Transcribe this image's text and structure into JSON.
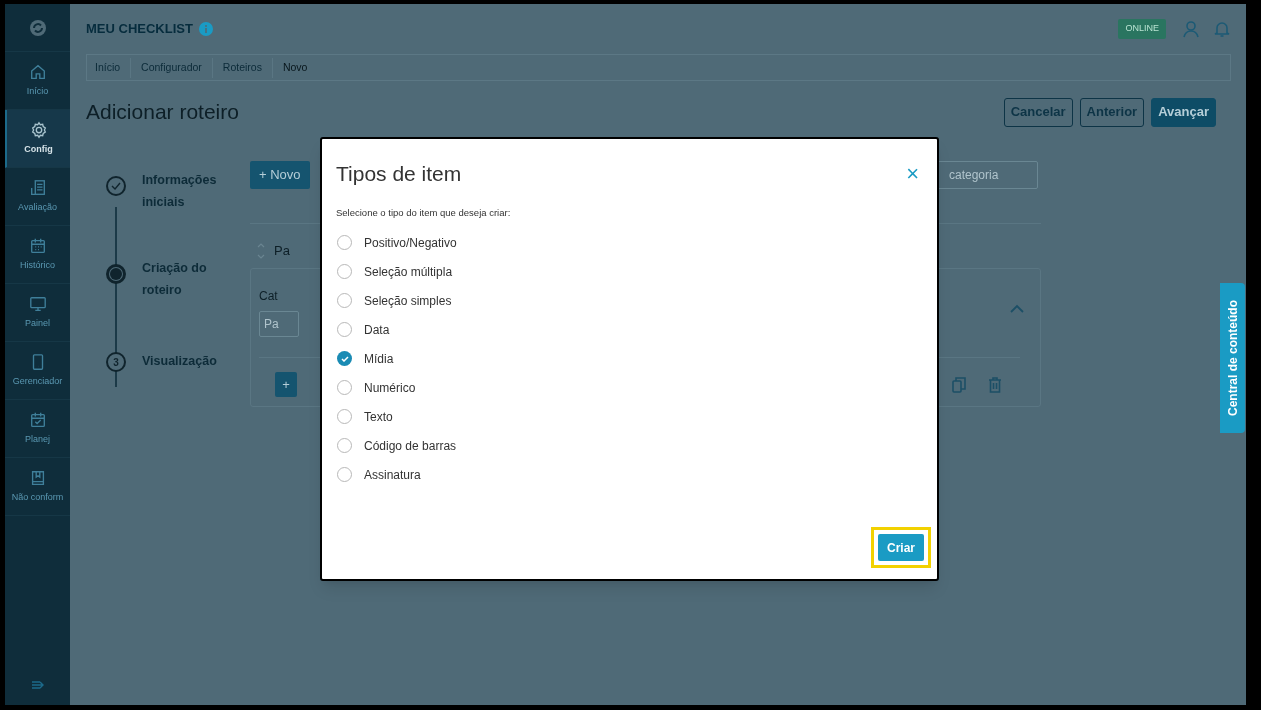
{
  "app": {
    "title": "MEU CHECKLIST"
  },
  "sidebar": {
    "items": [
      {
        "label": "Início",
        "kind": "home",
        "selected": false
      },
      {
        "label": "Config",
        "kind": "gear",
        "selected": true
      },
      {
        "label": "Avaliação",
        "kind": "sheet",
        "selected": false
      },
      {
        "label": "Histórico",
        "kind": "calendar",
        "selected": false
      },
      {
        "label": "Painel",
        "kind": "monitor",
        "selected": false
      },
      {
        "label": "Gerenciador",
        "kind": "phone",
        "selected": false
      },
      {
        "label": "Planej",
        "kind": "calendar-check",
        "selected": false
      },
      {
        "label": "Não conform",
        "kind": "book",
        "selected": false
      }
    ]
  },
  "header": {
    "status": "ONLINE"
  },
  "breadcrumb": [
    "Início",
    "Configurador",
    "Roteiros",
    "Novo"
  ],
  "page": {
    "title": "Adicionar roteiro",
    "actions": [
      {
        "label": "Cancelar",
        "kind": "outline"
      },
      {
        "label": "Anterior",
        "kind": "outline"
      },
      {
        "label": "Avançar",
        "kind": "primary"
      }
    ]
  },
  "steps": [
    {
      "label": "Informações iniciais",
      "done": true,
      "current": false
    },
    {
      "label": "Criação do roteiro",
      "done": false,
      "current": true
    },
    {
      "label": "Visualização",
      "done": false,
      "current": false,
      "number": "3"
    }
  ],
  "editor": {
    "new_button": "+ Novo",
    "sort_label": "Pa",
    "card_label": "Cat",
    "field_placeholder": "Pa",
    "category_placeholder": "categoria",
    "add_button": "+"
  },
  "dialog": {
    "title": "Tipos de item",
    "close": "×",
    "prompt": "Selecione o tipo do item que deseja criar:",
    "options": [
      {
        "label": "Positivo/Negativo",
        "selected": false
      },
      {
        "label": "Seleção múltipla",
        "selected": false
      },
      {
        "label": "Seleção simples",
        "selected": false
      },
      {
        "label": "Data",
        "selected": false
      },
      {
        "label": "Mídia",
        "selected": true
      },
      {
        "label": "Numérico",
        "selected": false
      },
      {
        "label": "Texto",
        "selected": false
      },
      {
        "label": "Código de barras",
        "selected": false
      },
      {
        "label": "Assinatura",
        "selected": false
      }
    ],
    "create_button": "Criar",
    "create_highlighted": true
  },
  "side_tab": "Central de conteúdo"
}
